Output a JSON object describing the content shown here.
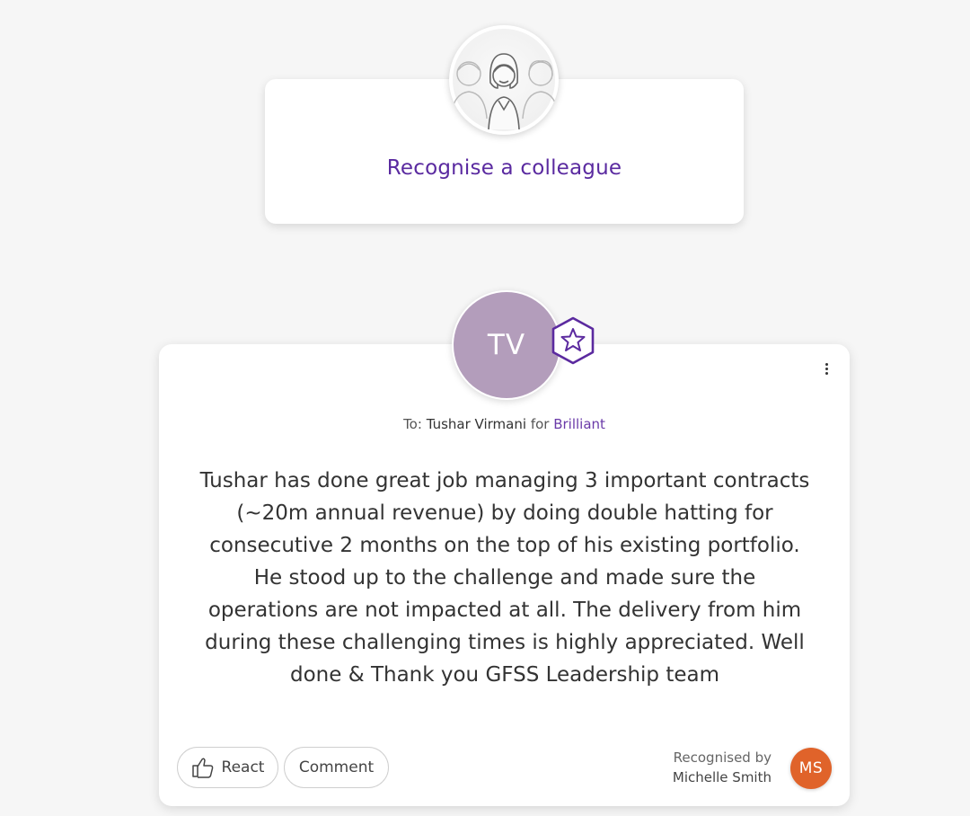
{
  "recognise": {
    "label": "Recognise a colleague",
    "illustration_icon": "colleagues-icon"
  },
  "post": {
    "recipient_initials": "TV",
    "recipient_avatar_color": "#b39dbb",
    "badge_icon": "star-hexagon-icon",
    "to_prefix": "To:",
    "recipient_name": "Tushar Virmani",
    "for_word": "for",
    "value": "Brilliant",
    "message": "Tushar has done great job managing 3 important contracts (~20m annual revenue) by doing double hatting for consecutive 2 months on the top of his existing portfolio. He stood up to the challenge and made sure the operations are not impacted at all. The delivery from him during these challenging times is highly appreciated. Well done & Thank you GFSS Leadership team",
    "react_label": "React",
    "comment_label": "Comment",
    "recognised_by_label": "Recognised by",
    "giver_name": "Michelle Smith",
    "giver_initials": "MS",
    "giver_avatar_color": "#e0632a"
  },
  "colors": {
    "accent": "#5a2aa0",
    "background": "#f6f6f6"
  }
}
